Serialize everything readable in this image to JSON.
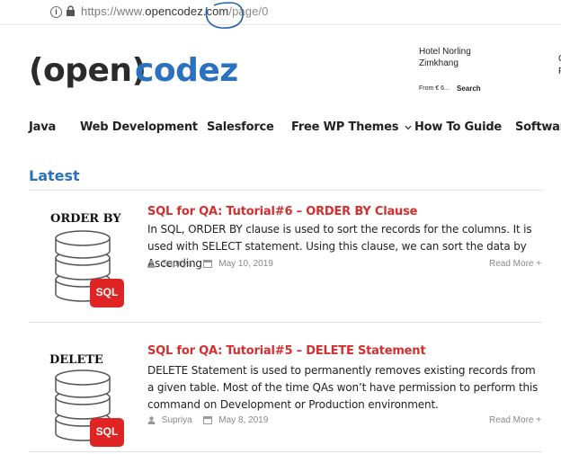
{
  "browser": {
    "url_scheme": "https://www.",
    "url_domain": "opencodez.com",
    "url_path": "/page/0"
  },
  "header": {
    "logo_open": "(open)",
    "logo_codez": "codez",
    "ad": {
      "line1": "Hotel Norling",
      "line2": "Zimkhang",
      "price": "From € 6...",
      "search": "Search",
      "right1": "C",
      "right2": "F"
    }
  },
  "nav": {
    "items": [
      {
        "label": "Java"
      },
      {
        "label": "Web Development"
      },
      {
        "label": "Salesforce"
      },
      {
        "label": "Free WP Themes"
      },
      {
        "label": "How To Guide"
      },
      {
        "label": "Software"
      }
    ]
  },
  "main": {
    "section_title": "Latest",
    "posts": [
      {
        "thumb_label": "ORDER BY",
        "badge": "SQL",
        "title": "SQL for QA: Tutorial#6 – ORDER BY Clause",
        "body": "In SQL, ORDER BY clause is used to sort the records for the columns. It is used with SELECT statement. Using this clause, we can sort the data by Ascending",
        "author": "Supriya",
        "date": "May 10, 2019",
        "read_more": "Read More +"
      },
      {
        "thumb_label": "DELETE",
        "badge": "SQL",
        "title": "SQL for QA: Tutorial#5 – DELETE Statement",
        "body": "DELETE Statement is used to permanently removes existing records from a given table. Most of the time QAs won’t have permission to perform this command on Development or Production environment.",
        "author": "Supriya",
        "date": "May 8, 2019",
        "read_more": "Read More +"
      }
    ]
  },
  "colors": {
    "brand_blue": "#2b71c0",
    "title_red": "#d32f2f",
    "badge_red": "#e02424",
    "annotation_blue": "#1f5fb0"
  }
}
